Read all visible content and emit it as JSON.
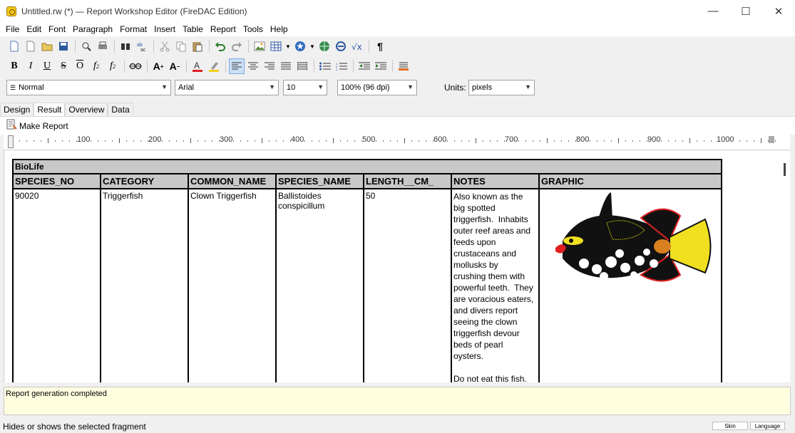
{
  "window": {
    "title": "Untitled.rw (*) — Report Workshop Editor (FireDAC Edition)",
    "minimize": "—",
    "maximize": "☐",
    "close": "✕"
  },
  "menu": [
    "File",
    "Edit",
    "Font",
    "Paragraph",
    "Format",
    "Insert",
    "Table",
    "Report",
    "Tools",
    "Help"
  ],
  "format": {
    "style": "Normal",
    "font": "Arial",
    "size": "10",
    "zoom": "100% (96 dpi)",
    "units_label": "Units:",
    "units": "pixels"
  },
  "tabs": [
    "Design",
    "Result",
    "Overview",
    "Data"
  ],
  "active_tab": "Result",
  "make_report": "Make Report",
  "ruler": {
    "labels": [
      "100",
      "200",
      "300",
      "400",
      "500",
      "600",
      "700",
      "800",
      "900",
      "1000"
    ]
  },
  "report": {
    "title": "BioLife",
    "headers": [
      "SPECIES_NO",
      "CATEGORY",
      "COMMON_NAME",
      "SPECIES_NAME",
      "LENGTH__CM_",
      "NOTES",
      "GRAPHIC"
    ],
    "row": {
      "species_no": "90020",
      "category": "Triggerfish",
      "common_name": "Clown Triggerfish",
      "species_name": "Ballistoides conspicillum",
      "length": "50",
      "notes": "Also known as the\nbig spotted\ntriggerfish.  Inhabits\nouter reef areas and\nfeeds upon\ncrustaceans and\nmollusks by\ncrushing them with\npowerful teeth.  They\nare voracious eaters,\nand divers report\nseeing the clown\ntriggerfish devour\nbeds of pearl\noysters.\n\nDo not eat this fish."
    }
  },
  "log": "Report generation completed",
  "status": "Hides or shows the selected fragment",
  "status_buttons": {
    "skin": "Skin",
    "language": "Language"
  }
}
